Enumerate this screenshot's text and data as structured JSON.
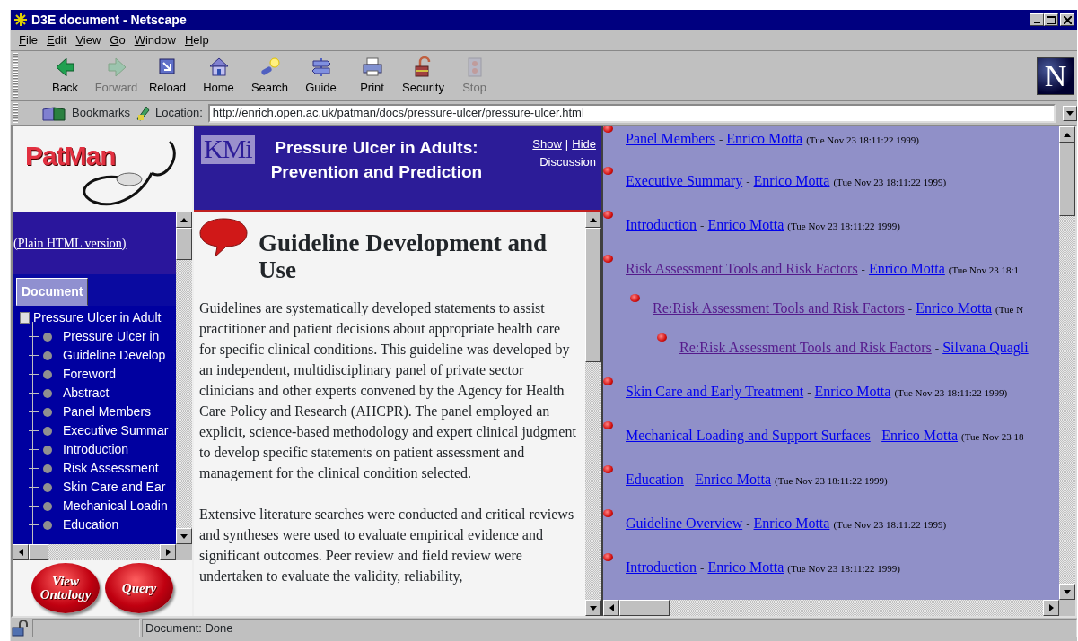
{
  "window": {
    "title": "D3E document - Netscape"
  },
  "menu": [
    {
      "label": "File"
    },
    {
      "label": "Edit"
    },
    {
      "label": "View"
    },
    {
      "label": "Go"
    },
    {
      "label": "Window"
    },
    {
      "label": "Help"
    }
  ],
  "toolbar": [
    {
      "label": "Back",
      "disabled": false
    },
    {
      "label": "Forward",
      "disabled": true
    },
    {
      "label": "Reload",
      "disabled": false
    },
    {
      "label": "Home",
      "disabled": false
    },
    {
      "label": "Search",
      "disabled": false
    },
    {
      "label": "Guide",
      "disabled": false
    },
    {
      "label": "Print",
      "disabled": false
    },
    {
      "label": "Security",
      "disabled": false
    },
    {
      "label": "Stop",
      "disabled": true
    }
  ],
  "throbber": "N",
  "location": {
    "bookmarks": "Bookmarks",
    "label": "Location:",
    "url": "http://enrich.open.ac.uk/patman/docs/pressure-ulcer/pressure-ulcer.html"
  },
  "sidebar": {
    "logo": "PatMan",
    "plain_link": "(Plain HTML version)",
    "tab": {
      "label": "Document",
      "selected": true
    },
    "tree": {
      "label": "Pressure Ulcer in Adult",
      "children": [
        {
          "label": "Pressure Ulcer in"
        },
        {
          "label": "Guideline Develop"
        },
        {
          "label": "Foreword"
        },
        {
          "label": "Abstract"
        },
        {
          "label": "Panel Members"
        },
        {
          "label": "Executive Summar"
        },
        {
          "label": "Introduction"
        },
        {
          "label": "Risk Assessment"
        },
        {
          "label": "Skin Care and Ear"
        },
        {
          "label": "Mechanical Loadin"
        },
        {
          "label": "Education"
        }
      ]
    },
    "buttons": [
      "View Ontology",
      "Query"
    ]
  },
  "header": {
    "logo": "KMi",
    "title_lines": [
      "Pressure Ulcer in Adults:",
      "Prevention and Prediction"
    ],
    "show": "Show",
    "separator": "|",
    "hide": "Hide",
    "discussion": "Discussion"
  },
  "document": {
    "heading": "Guideline Development and Use",
    "paragraphs": [
      "Guidelines are systematically developed statements to assist practitioner and patient decisions about appropriate health care for specific clinical conditions. This guideline was developed by an independent, multidisciplinary panel of private sector clinicians and other experts convened by the Agency for Health Care Policy and Research (AHCPR). The panel employed an explicit, science-based methodology and expert clinical judgment to develop specific statements on patient assessment and management for the clinical condition selected.",
      "Extensive literature searches were conducted and critical reviews and syntheses were used to evaluate empirical evidence and significant outcomes. Peer review and field review were undertaken to evaluate the validity, reliability,"
    ]
  },
  "discussion": {
    "items": [
      {
        "title": "Panel Members",
        "visited": false,
        "separator": "-",
        "author": "Enrico Motta",
        "date": "(Tue Nov 23 18:11:22 1999)"
      },
      {
        "title": "Executive Summary",
        "visited": false,
        "separator": "-",
        "author": "Enrico Motta",
        "date": "(Tue Nov 23 18:11:22 1999)"
      },
      {
        "title": "Introduction",
        "visited": false,
        "separator": "-",
        "author": "Enrico Motta",
        "date": "(Tue Nov 23 18:11:22 1999)"
      },
      {
        "title": "Risk Assessment Tools and Risk Factors",
        "visited": true,
        "separator": "-",
        "author": "Enrico Motta",
        "date": "(Tue Nov 23 18:1",
        "children": [
          {
            "title": "Re:Risk Assessment Tools and Risk Factors",
            "visited": true,
            "separator": "-",
            "author": "Enrico Motta",
            "date": "(Tue N",
            "children": [
              {
                "title": "Re:Risk Assessment Tools and Risk Factors",
                "visited": true,
                "separator": "-",
                "author": "Silvana Quagli"
              }
            ]
          }
        ]
      },
      {
        "title": "Skin Care and Early Treatment",
        "visited": false,
        "separator": "-",
        "author": "Enrico Motta",
        "date": "(Tue Nov 23 18:11:22 1999)"
      },
      {
        "title": "Mechanical Loading and Support Surfaces",
        "visited": false,
        "separator": "-",
        "author": "Enrico Motta",
        "date": "(Tue Nov 23 18"
      },
      {
        "title": "Education",
        "visited": false,
        "separator": "-",
        "author": "Enrico Motta",
        "date": "(Tue Nov 23 18:11:22 1999)"
      },
      {
        "title": "Guideline Overview",
        "visited": false,
        "separator": "-",
        "author": "Enrico Motta",
        "date": "(Tue Nov 23 18:11:22 1999)"
      },
      {
        "title": "Introduction",
        "visited": false,
        "separator": "-",
        "author": "Enrico Motta",
        "date": "(Tue Nov 23 18:11:22 1999)"
      }
    ]
  },
  "status_bar": {
    "text": "Document: Done"
  }
}
